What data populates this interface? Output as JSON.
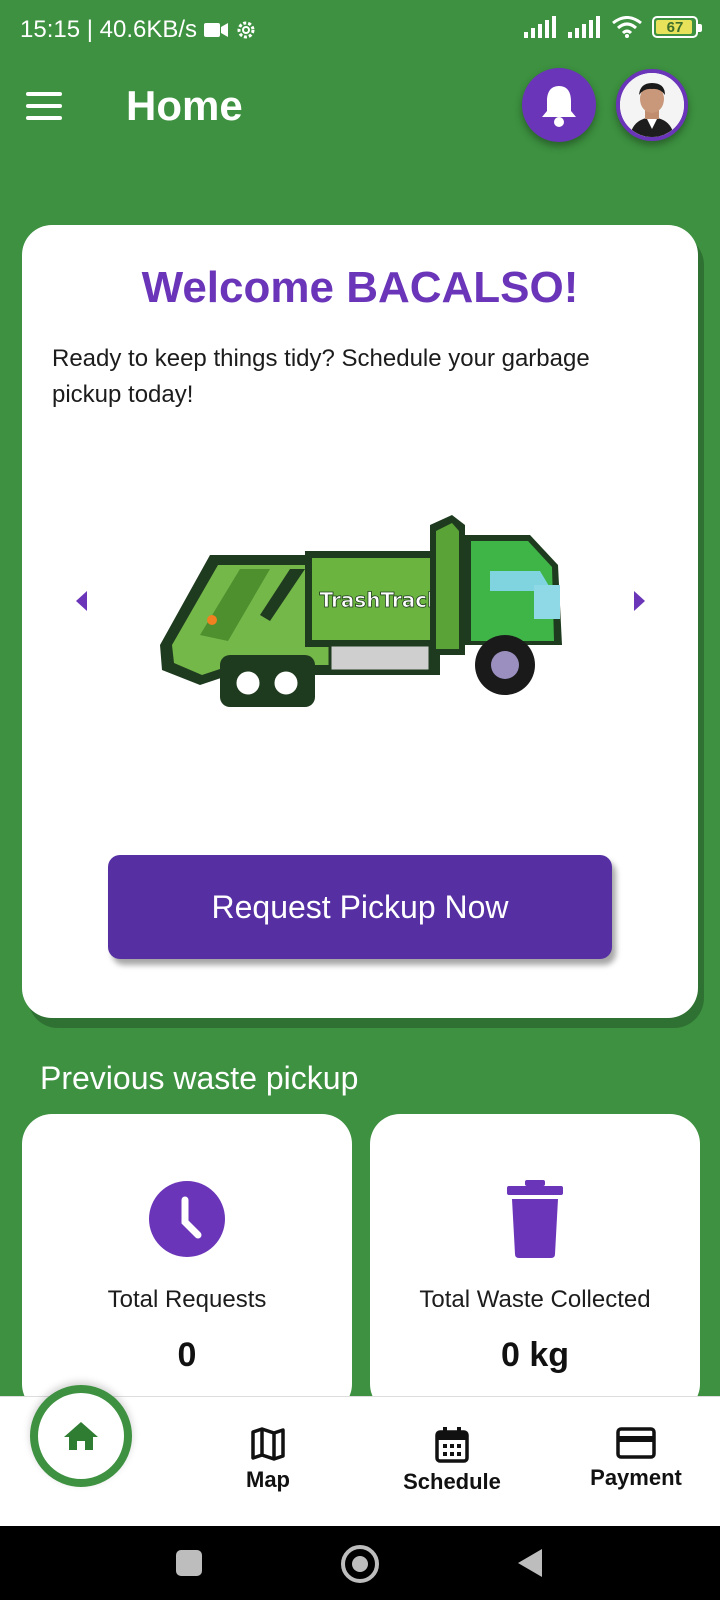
{
  "status_bar": {
    "time_speed": "15:15 | 40.6KB/s",
    "battery_level": "67"
  },
  "header": {
    "title": "Home"
  },
  "welcome_card": {
    "title": "Welcome BACALSO!",
    "message": "Ready to keep things tidy? Schedule your garbage pickup today!",
    "truck_brand": "TrashTrack",
    "request_button_label": "Request Pickup Now"
  },
  "previous_pickup": {
    "section_title": "Previous waste pickup",
    "total_requests_label": "Total Requests",
    "total_requests_value": "0",
    "total_waste_label": "Total Waste Collected",
    "total_waste_value": "0 kg"
  },
  "bottom_nav": {
    "items": [
      {
        "label": "Map"
      },
      {
        "label": "Schedule"
      },
      {
        "label": "Payment"
      }
    ]
  },
  "colors": {
    "background_green": "#3d9140",
    "accent_purple": "#6a35b8",
    "button_purple": "#5630a3"
  }
}
